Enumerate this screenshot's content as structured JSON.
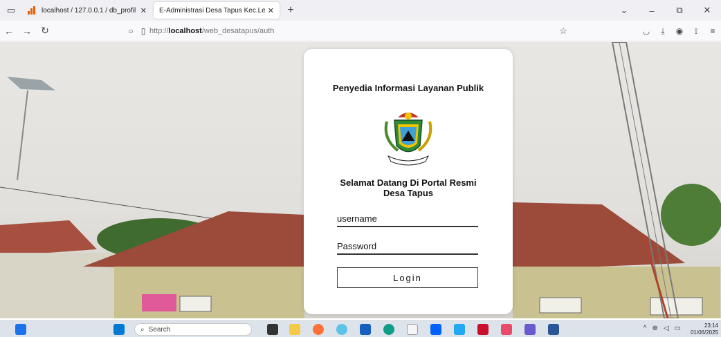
{
  "browser": {
    "tabs": [
      {
        "title": "localhost / 127.0.0.1 / db_profil",
        "active": false
      },
      {
        "title": "E-Administrasi Desa Tapus Kec.Lem",
        "active": true
      }
    ],
    "new_tab": "+",
    "url_prefix": "http://",
    "url_host": "localhost",
    "url_path": "/web_desatapus/auth"
  },
  "login": {
    "title": "Penyedia Informasi Layanan Publik",
    "welcome": "Selamat Datang Di Portal Resmi Desa Tapus",
    "username_placeholder": "username",
    "password_placeholder": "Password",
    "login_label": "Login"
  },
  "taskbar": {
    "search_placeholder": "Search",
    "time": "23:14",
    "date": "01/06/2025"
  },
  "colors": {
    "accent": "#333333",
    "emblem_green": "#2e8b3a",
    "emblem_yellow": "#f2c400",
    "emblem_red": "#c0392b"
  }
}
